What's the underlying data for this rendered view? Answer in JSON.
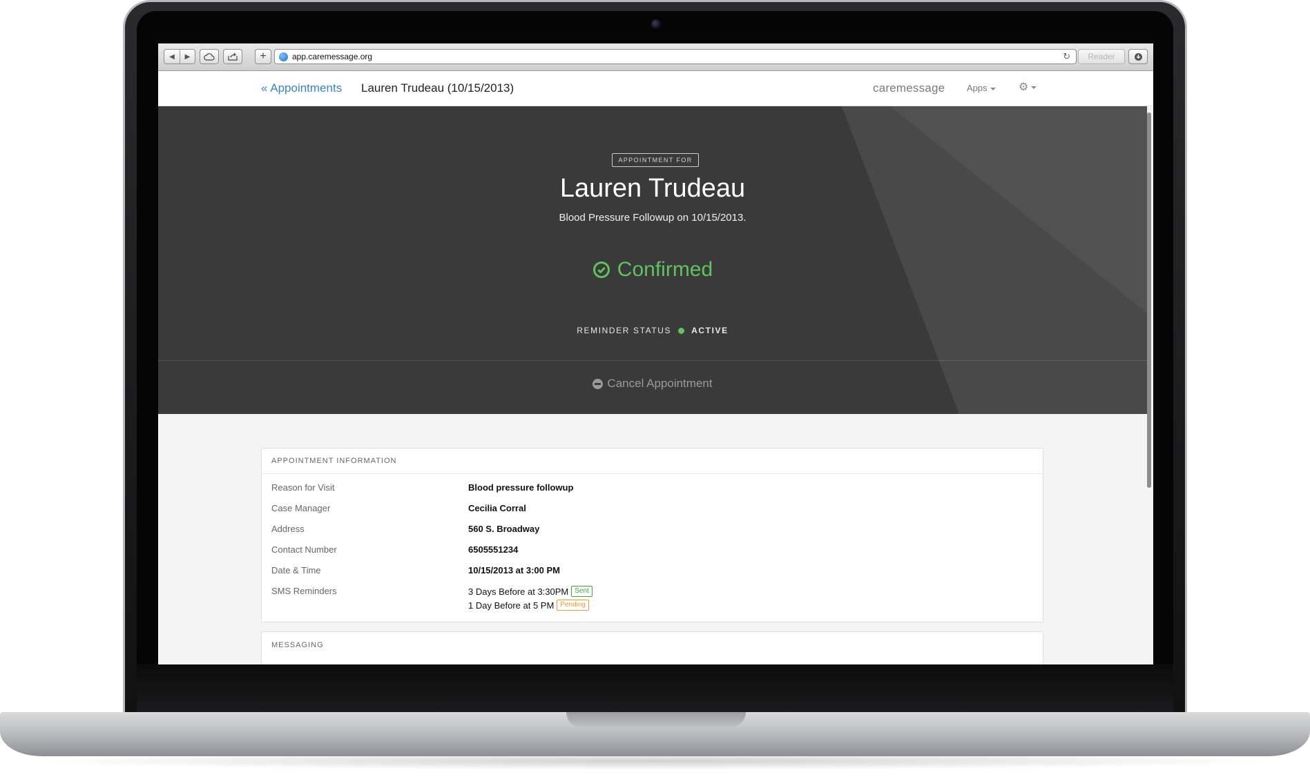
{
  "browser": {
    "url": "app.caremessage.org",
    "reader_label": "Reader"
  },
  "navbar": {
    "back_link": "« Appointments",
    "title": "Lauren Trudeau (10/15/2013)",
    "brand": "caremessage",
    "apps_label": "Apps"
  },
  "hero": {
    "badge": "APPOINTMENT FOR",
    "patient_name": "Lauren Trudeau",
    "subtitle": "Blood Pressure Followup on 10/15/2013.",
    "status": "Confirmed",
    "reminder_label": "REMINDER STATUS",
    "reminder_value": "ACTIVE",
    "cancel_label": "Cancel Appointment",
    "status_color": "#5fc45f"
  },
  "appointment_info": {
    "heading": "APPOINTMENT INFORMATION",
    "rows": [
      {
        "label": "Reason for Visit",
        "value": "Blood pressure followup"
      },
      {
        "label": "Case Manager",
        "value": "Cecilia Corral"
      },
      {
        "label": "Address",
        "value": "560 S. Broadway"
      },
      {
        "label": "Contact Number",
        "value": "6505551234"
      },
      {
        "label": "Date & Time",
        "value": "10/15/2013 at 3:00 PM"
      }
    ],
    "sms_label": "SMS Reminders",
    "sms_reminders": [
      {
        "text": "3 Days Before at 3:30PM",
        "status": "Sent"
      },
      {
        "text": "1 Day Before at 5 PM",
        "status": "Pending"
      }
    ]
  },
  "messaging": {
    "heading": "MESSAGING"
  }
}
